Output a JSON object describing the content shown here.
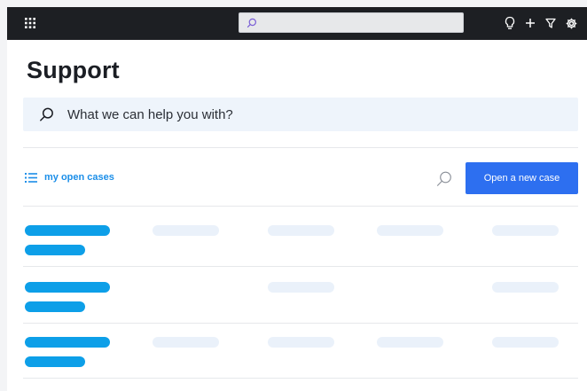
{
  "page": {
    "title": "Support"
  },
  "help_search": {
    "placeholder": "What we can help you with?"
  },
  "cases": {
    "link_label": "my open cases",
    "new_case_label": "Open a new case"
  },
  "icons": {
    "topbar": [
      "apps-grid-icon",
      "search-icon",
      "lightbulb-icon",
      "plus-icon",
      "filter-icon",
      "gear-icon"
    ],
    "main": [
      "search-icon",
      "list-icon",
      "search-icon"
    ]
  },
  "colors": {
    "topbar": "#1d1f23",
    "accent_button": "#2d6ff0",
    "link": "#1b8ee8",
    "placeholder_bar_strong": "#0d9fe8",
    "placeholder_bar_faint": "#eaf1fa",
    "search_bg": "#eef4fb"
  }
}
